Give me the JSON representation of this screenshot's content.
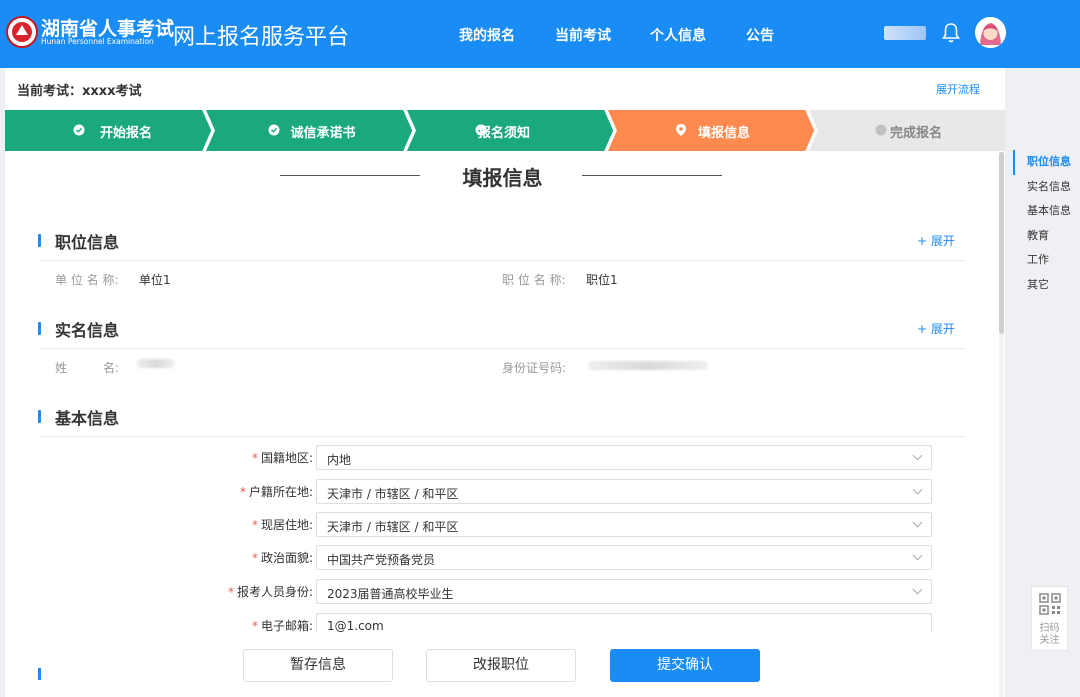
{
  "header": {
    "logo_cn": "湖南省人事考试",
    "logo_en": "Hunan Personnel Examination",
    "platform_title": "网上报名服务平台",
    "nav": [
      "我的报名",
      "当前考试",
      "个人信息",
      "公告"
    ],
    "accent_color": "#1a8cf5"
  },
  "exam": {
    "current_label": "当前考试：xxxx考试",
    "expand_flow": "展开流程"
  },
  "steps": [
    {
      "label": "开始报名",
      "status": "done"
    },
    {
      "label": "诚信承诺书",
      "status": "done"
    },
    {
      "label": "报名须知",
      "status": "done"
    },
    {
      "label": "填报信息",
      "status": "current"
    },
    {
      "label": "完成报名",
      "status": "pending"
    }
  ],
  "page_title": "填报信息",
  "sections": {
    "position": {
      "title": "职位信息",
      "expand": "+ 展开",
      "unit_label": "单 位 名 称:",
      "unit_value": "单位1",
      "job_label": "职 位 名 称:",
      "job_value": "职位1"
    },
    "realname": {
      "title": "实名信息",
      "expand": "+ 展开",
      "name_label": "姓　　　名:",
      "id_label": "身份证号码:"
    },
    "basic": {
      "title": "基本信息"
    }
  },
  "form": [
    {
      "label": "国籍地区:",
      "value": "内地"
    },
    {
      "label": "户籍所在地:",
      "value": "天津市 / 市辖区 / 和平区"
    },
    {
      "label": "现居住地:",
      "value": "天津市 / 市辖区 / 和平区"
    },
    {
      "label": "政治面貌:",
      "value": "中国共产党预备党员"
    },
    {
      "label": "报考人员身份:",
      "value": "2023届普通高校毕业生"
    },
    {
      "label": "电子邮箱:",
      "value": "1@1.com"
    }
  ],
  "buttons": {
    "save": "暂存信息",
    "change": "改报职位",
    "submit": "提交确认"
  },
  "side_nav": [
    "职位信息",
    "实名信息",
    "基本信息",
    "教育",
    "工作",
    "其它"
  ],
  "qr": {
    "label": "扫码\n关注"
  },
  "colors": {
    "step_done": "#1aa97f",
    "step_current": "#ff8a50",
    "step_pending": "#e8e8e8",
    "required": "#f0574f"
  }
}
